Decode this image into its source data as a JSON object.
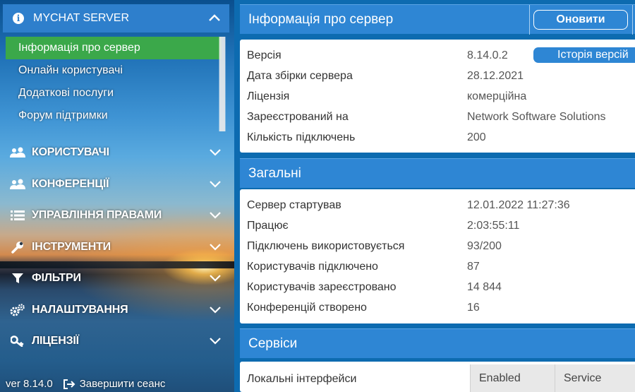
{
  "sidebar": {
    "header_title": "MYCHAT SERVER",
    "submenu": [
      {
        "label": "Інформація про сервер",
        "active": true
      },
      {
        "label": "Онлайн користувачі",
        "active": false
      },
      {
        "label": "Додаткові послуги",
        "active": false
      },
      {
        "label": "Форум підтримки",
        "active": false
      }
    ],
    "nav": [
      {
        "label": "КОРИСТУВАЧІ",
        "icon": "users-icon"
      },
      {
        "label": "КОНФЕРЕНЦІЇ",
        "icon": "conferences-icon"
      },
      {
        "label": "УПРАВЛІННЯ ПРАВАМИ",
        "icon": "list-icon"
      },
      {
        "label": "ІНСТРУМЕНТИ",
        "icon": "wrench-icon"
      },
      {
        "label": "ФІЛЬТРИ",
        "icon": "filter-icon"
      },
      {
        "label": "НАЛАШТУВАННЯ",
        "icon": "gears-icon"
      },
      {
        "label": "ЛІЦЕНЗІЇ",
        "icon": "key-icon"
      }
    ],
    "version": "ver 8.14.0",
    "logout_label": "Завершити сеанс"
  },
  "server_info": {
    "title": "Інформація про сервер",
    "refresh_label": "Оновити",
    "history_label": "Історія версій",
    "rows": [
      {
        "key": "Версія",
        "value": "8.14.0.2"
      },
      {
        "key": "Дата збірки сервера",
        "value": "28.12.2021"
      },
      {
        "key": "Ліцензія",
        "value": "комерційна"
      },
      {
        "key": "Зареєстрований на",
        "value": "Network Software Solutions"
      },
      {
        "key": "Кількість підключень",
        "value": "200"
      }
    ]
  },
  "general": {
    "title": "Загальні",
    "rows": [
      {
        "key": "Сервер стартував",
        "value": "12.01.2022 11:27:36"
      },
      {
        "key": "Працює",
        "value": "2:03:55:11"
      },
      {
        "key": "Підключень використовується",
        "value": "93/200"
      },
      {
        "key": "Користувачів підключено",
        "value": "87"
      },
      {
        "key": "Користувачів зареєстровано",
        "value": "14 844"
      },
      {
        "key": "Конференцій створено",
        "value": "16"
      }
    ]
  },
  "services": {
    "title": "Сервіси",
    "row_label": "Локальні інтерфейси",
    "columns": [
      "Enabled",
      "Service"
    ]
  },
  "colors": {
    "accent": "#2e86d4",
    "active_item": "#3ba84a",
    "main_bg": "#0d6bb0"
  }
}
